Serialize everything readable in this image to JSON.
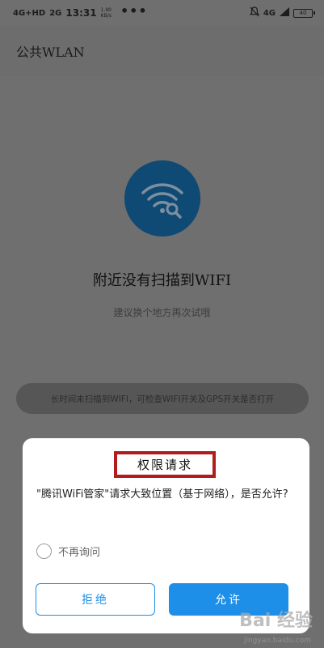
{
  "status_bar": {
    "network_1": "4G+HD",
    "network_2": "2G",
    "time": "13:31",
    "speed_value": "1.90",
    "speed_unit": "KB/s",
    "overflow": "•••",
    "network_right": "4G",
    "battery": "40"
  },
  "app_bar": {
    "title": "公共WLAN"
  },
  "empty_state": {
    "icon": "wifi-search-icon",
    "title": "附近没有扫描到WIFI",
    "subtitle": "建议换个地方再次试哦",
    "hint": "长时间未扫描到WIFI，可检查WIFI开关及GPS开关是否打开"
  },
  "dialog": {
    "title": "权限请求",
    "message": "\"腾讯WiFi管家\"请求大致位置（基于网络），是否允许?",
    "dont_ask_label": "不再询问",
    "deny_label": "拒绝",
    "allow_label": "允许"
  },
  "watermark": {
    "text": "Bai 经验",
    "url": "jingyan.baidu.com"
  },
  "colors": {
    "overlay_bg": "#6f6f6f",
    "wifi_circle": "#0e4a73",
    "accent_blue": "#1e8fe8",
    "highlight_red": "#b11c1c"
  }
}
